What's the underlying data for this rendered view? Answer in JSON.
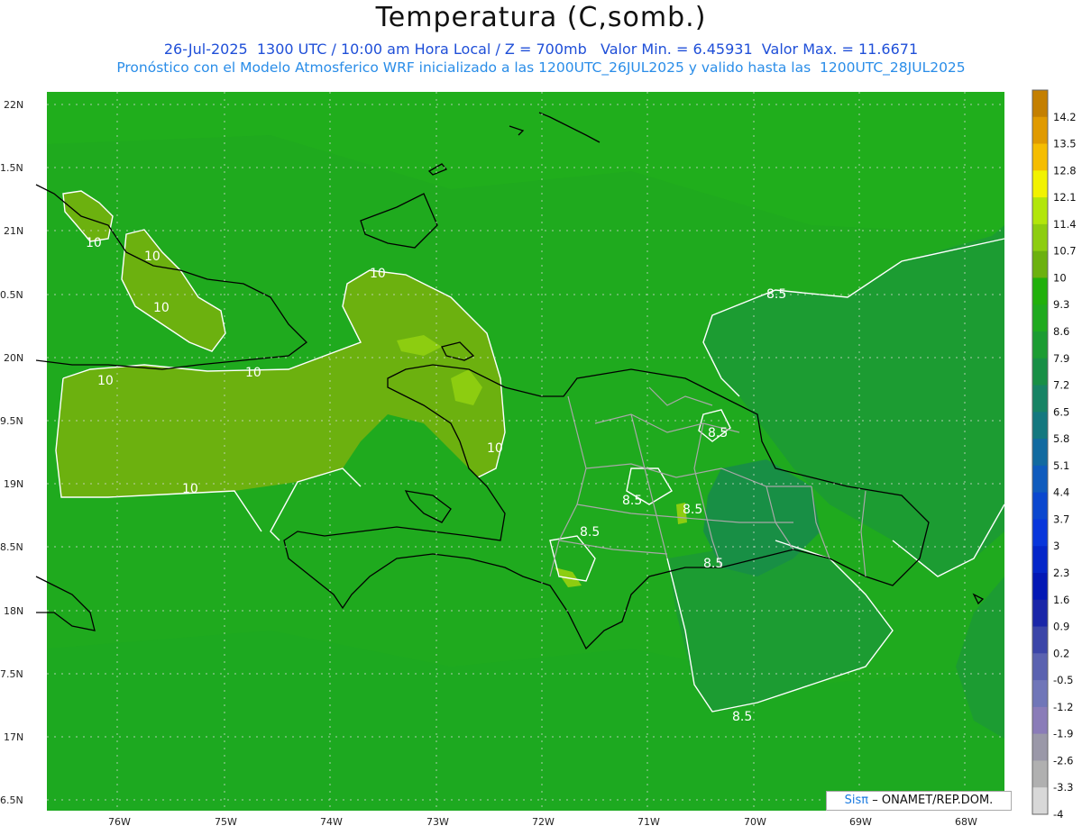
{
  "header": {
    "title": "Temperatura (C,somb.)",
    "line1": "26-Jul-2025  1300 UTC / 10:00 am Hora Local / Z = 700mb   Valor Min. = 6.45931  Valor Max. = 11.6671",
    "line2": "Pronóstico con el Modelo Atmosferico WRF inicializado a las 1200UTC_26JUL2025 y valido hasta las  1200UTC_28JUL2025"
  },
  "axes": {
    "lat_labels": [
      "22N",
      "1.5N",
      "21N",
      "0.5N",
      "20N",
      "9.5N",
      "19N",
      "8.5N",
      "18N",
      "7.5N",
      "17N",
      "6.5N"
    ],
    "lon_labels": [
      "76W",
      "75W",
      "74W",
      "73W",
      "72W",
      "71W",
      "70W",
      "69W",
      "68W"
    ]
  },
  "contour_labels": {
    "ten": "10",
    "eight_five": "8.5"
  },
  "colorbar": {
    "levels": [
      {
        "label": "14.2",
        "color": "#c47f00"
      },
      {
        "label": "13.5",
        "color": "#e09a00"
      },
      {
        "label": "12.8",
        "color": "#f5bd00"
      },
      {
        "label": "12.1",
        "color": "#f2f200"
      },
      {
        "label": "11.4",
        "color": "#b2e60b"
      },
      {
        "label": "10.7",
        "color": "#8dcd10"
      },
      {
        "label": "10",
        "color": "#6cb10f"
      },
      {
        "label": "9.3",
        "color": "#21b00b"
      },
      {
        "label": "8.6",
        "color": "#1faa1e"
      },
      {
        "label": "7.9",
        "color": "#1c9c32"
      },
      {
        "label": "7.2",
        "color": "#188f45"
      },
      {
        "label": "6.5",
        "color": "#178364"
      },
      {
        "label": "5.8",
        "color": "#14787f"
      },
      {
        "label": "5.1",
        "color": "#126aa0"
      },
      {
        "label": "4.4",
        "color": "#0f5bbd"
      },
      {
        "label": "3.7",
        "color": "#0a47cf"
      },
      {
        "label": "3",
        "color": "#0836db"
      },
      {
        "label": "2.3",
        "color": "#0426c9"
      },
      {
        "label": "1.6",
        "color": "#0318b5"
      },
      {
        "label": "0.9",
        "color": "#1a26a8"
      },
      {
        "label": "0.2",
        "color": "#3b45a8"
      },
      {
        "label": "-0.5",
        "color": "#5a62b0"
      },
      {
        "label": "-1.2",
        "color": "#7076b8"
      },
      {
        "label": "-1.9",
        "color": "#8a7cb8"
      },
      {
        "label": "-2.6",
        "color": "#9a98a8"
      },
      {
        "label": "-3.3",
        "color": "#b0b0b0"
      },
      {
        "label": "-4",
        "color": "#d8d8d8"
      }
    ]
  },
  "credit": {
    "brand": "Sisπ",
    "text": "– ONAMET/REP.DOM."
  },
  "colors": {
    "field_green": "#1faa1e",
    "warm_olive": "#6cb10f",
    "cool_green": "#178f44",
    "coast": "#000000",
    "borders": "#a0a0a0",
    "contour": "#ffffff"
  }
}
